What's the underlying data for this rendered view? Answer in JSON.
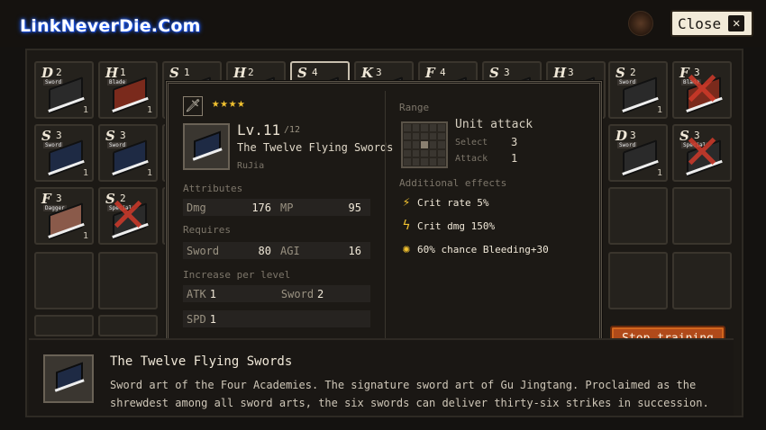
{
  "watermark": "LinkNeverDie.Com",
  "header": {
    "close_label": "Close",
    "close_icon": "x-icon"
  },
  "inventory": [
    {
      "grade": "D",
      "count": "2",
      "tag": "Sword",
      "qty": "1",
      "color": "#2a2a2a",
      "crossed": false
    },
    {
      "grade": "H",
      "count": "1",
      "tag": "Blade",
      "qty": "1",
      "color": "#7a2a1c",
      "crossed": false
    },
    {
      "grade": "S",
      "count": "1",
      "tag": "",
      "qty": "",
      "color": "#333",
      "crossed": false
    },
    {
      "grade": "H",
      "count": "2",
      "tag": "",
      "qty": "",
      "color": "#333",
      "crossed": false
    },
    {
      "grade": "S",
      "count": "4",
      "tag": "",
      "qty": "",
      "color": "#333",
      "crossed": false
    },
    {
      "grade": "K",
      "count": "3",
      "tag": "",
      "qty": "",
      "color": "#333",
      "crossed": false
    },
    {
      "grade": "F",
      "count": "4",
      "tag": "",
      "qty": "",
      "color": "#333",
      "crossed": false
    },
    {
      "grade": "S",
      "count": "3",
      "tag": "",
      "qty": "",
      "color": "#333",
      "crossed": false
    },
    {
      "grade": "H",
      "count": "3",
      "tag": "",
      "qty": "",
      "color": "#333",
      "crossed": false
    },
    {
      "grade": "S",
      "count": "2",
      "tag": "Sword",
      "qty": "1",
      "color": "#2a2a2a",
      "crossed": false
    },
    {
      "grade": "F",
      "count": "3",
      "tag": "Blade",
      "qty": "",
      "color": "#7a2a1c",
      "crossed": true
    },
    {
      "grade": "S",
      "count": "3",
      "tag": "Sword",
      "qty": "1",
      "color": "#1e2a44",
      "crossed": false
    },
    {
      "grade": "S",
      "count": "3",
      "tag": "Sword",
      "qty": "1",
      "color": "#1e2a44",
      "crossed": false
    },
    {
      "grade": "D",
      "count": "3",
      "tag": "Sword",
      "qty": "1",
      "color": "#2a2a2a",
      "crossed": false
    },
    {
      "grade": "S",
      "count": "3",
      "tag": "Special",
      "qty": "",
      "color": "#2a2a2a",
      "crossed": true
    },
    {
      "grade": "F",
      "count": "3",
      "tag": "Dagger",
      "qty": "1",
      "color": "#8a5a4a",
      "crossed": false
    },
    {
      "grade": "S",
      "count": "2",
      "tag": "Special",
      "qty": "",
      "color": "#2a2a2a",
      "crossed": true
    }
  ],
  "detail": {
    "stars": "★★★★",
    "level": "Lv.11",
    "level_max": "/12",
    "name": "The Twelve Flying Swords",
    "sect": "RuJia",
    "attributes_label": "Attributes",
    "dmg_key": "Dmg",
    "dmg_val": "176",
    "mp_key": "MP",
    "mp_val": "95",
    "requires_label": "Requires",
    "req_sword_key": "Sword",
    "req_sword_val": "80",
    "req_agi_key": "AGI",
    "req_agi_val": "16",
    "increase_label": "Increase per level",
    "atk_key": "ATK",
    "atk_val": "1",
    "sword_key": "Sword",
    "sword_val": "2",
    "spd_key": "SPD",
    "spd_val": "1",
    "range_label": "Range",
    "unit_attack": "Unit attack",
    "select_key": "Select",
    "select_val": "3",
    "attack_key": "Attack",
    "attack_val": "1",
    "effects_label": "Additional effects",
    "effects": [
      {
        "icon": "lightning-circle-icon",
        "text": "Crit rate 5%"
      },
      {
        "icon": "lightning-icon",
        "text": "Crit dmg 150%"
      },
      {
        "icon": "burst-icon",
        "text": "60% chance Bleeding+30"
      }
    ]
  },
  "stop_training_label": "Stop training",
  "description": {
    "title": "The Twelve Flying Swords",
    "text": "Sword art of the Four Academies. The signature sword art of Gu Jingtang. Proclaimed as the shrewdest among all sword arts, the six swords can deliver thirty-six strikes in succession."
  },
  "colors": {
    "accent": "#b04a1a",
    "star": "#f2c230",
    "cross": "#d03a2a"
  }
}
